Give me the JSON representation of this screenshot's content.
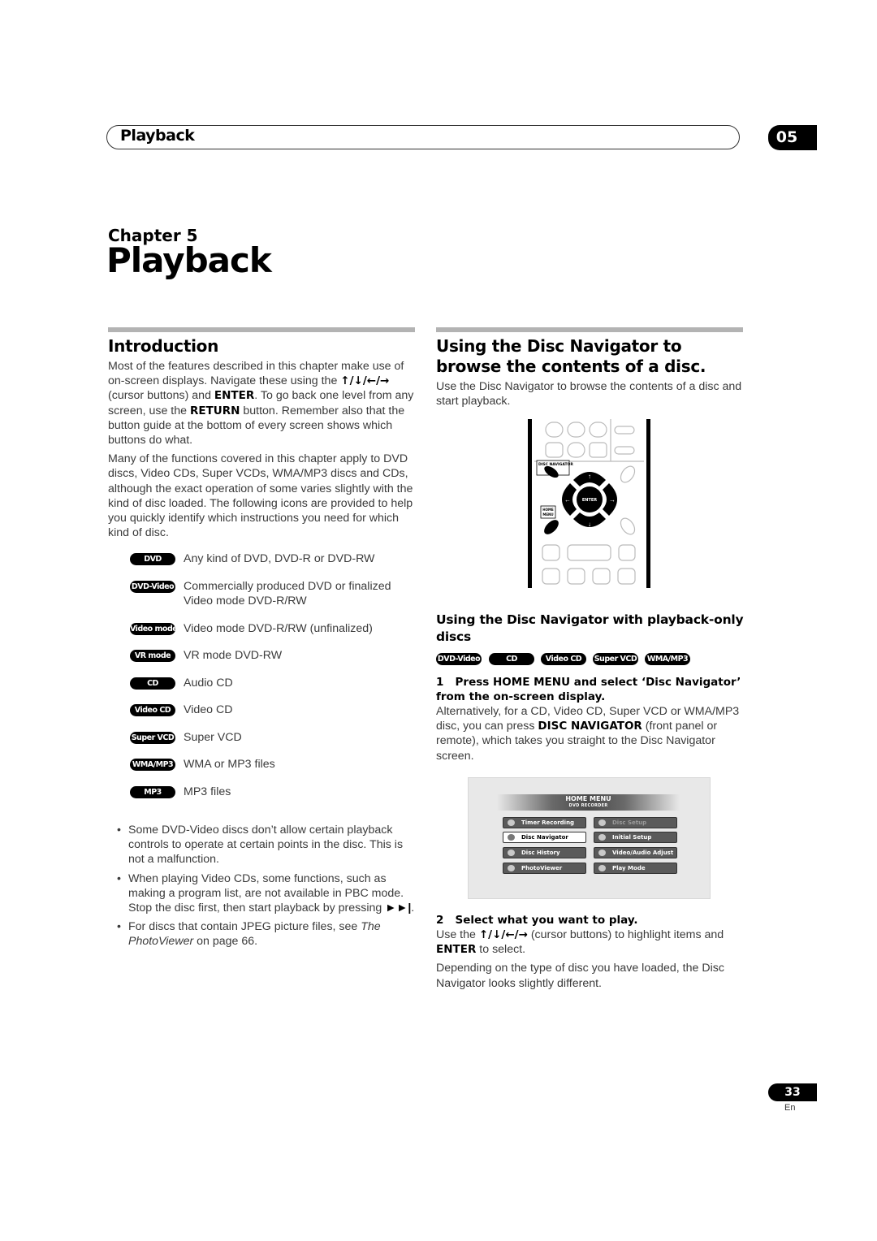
{
  "header": {
    "section_title": "Playback",
    "chapter_number": "05"
  },
  "chapter": {
    "label": "Chapter 5",
    "title": "Playback"
  },
  "introduction": {
    "heading": "Introduction",
    "para1": {
      "t1": "Most of the features described in this chapter make use of on-screen displays. Navigate these using the ",
      "arrows": "↑/↓/←/→",
      "t2": " (cursor buttons) and ",
      "b1": "ENTER",
      "t3": ". To go back one level from any screen, use the ",
      "b2": "RETURN",
      "t4": " button. Remember also that the button guide at the bottom of every screen shows which buttons do what."
    },
    "para2": "Many of the functions covered in this chapter apply to DVD discs, Video CDs, Super VCDs, WMA/MP3 discs and CDs, although the exact operation of some varies slightly with the kind of disc loaded. The following icons are provided to help you quickly identify which instructions you need for which kind of disc.",
    "disc_icons": [
      {
        "badge": "DVD",
        "desc": "Any kind of DVD, DVD-R or DVD-RW"
      },
      {
        "badge": "DVD-Video",
        "desc": "Commercially produced DVD or finalized Video mode DVD-R/RW"
      },
      {
        "badge": "Video mode",
        "desc": "Video mode DVD-R/RW (unfinalized)"
      },
      {
        "badge": "VR mode",
        "desc": "VR mode DVD-RW"
      },
      {
        "badge": "CD",
        "desc": "Audio CD"
      },
      {
        "badge": "Video CD",
        "desc": "Video CD"
      },
      {
        "badge": "Super VCD",
        "desc": "Super VCD"
      },
      {
        "badge": "WMA/MP3",
        "desc": "WMA or MP3 files"
      },
      {
        "badge": "MP3",
        "desc": "MP3 files"
      }
    ],
    "bullets": [
      {
        "text": "Some DVD-Video discs don’t allow certain playback controls to operate at certain points in the disc. This is not a malfunction."
      },
      {
        "text_before": "When playing Video CDs, some functions, such as making a program list, are not available in PBC mode. Stop the disc first, then start playback by pressing ",
        "symbol": "►►|",
        "text_after": "."
      },
      {
        "t1": "For discs that contain JPEG picture files, see ",
        "italic": "The PhotoViewer",
        "t2": " on page 66."
      }
    ],
    "bullet_char": "•"
  },
  "disc_navigator": {
    "heading": "Using the Disc Navigator to browse the contents of a disc.",
    "intro": "Use the Disc Navigator to browse the contents of a disc and start playback.",
    "remote": {
      "disc_navigator_label": "DISC NAVIGATOR",
      "home_menu_label_1": "HOME",
      "home_menu_label_2": "MENU",
      "enter_label": "ENTER"
    },
    "subheading": "Using the Disc Navigator with playback-only discs",
    "badges": [
      "DVD-Video",
      "CD",
      "Video CD",
      "Super VCD",
      "WMA/MP3"
    ],
    "step1": {
      "number": "1",
      "title": "Press HOME MENU and select ‘Disc Navigator’ from the on-screen display.",
      "t1": "Alternatively, for a CD, Video CD, Super VCD or WMA/MP3 disc, you can press ",
      "b1": "DISC NAVIGATOR",
      "t2": " (front panel or remote), which takes you straight to the Disc Navigator screen."
    },
    "home_menu": {
      "title": "HOME MENU",
      "subtitle": "DVD RECORDER",
      "left_items": [
        "Timer Recording",
        "Disc Navigator",
        "Disc History",
        "PhotoViewer"
      ],
      "right_items": [
        "Disc Setup",
        "Initial Setup",
        "Video/Audio Adjust",
        "Play Mode"
      ],
      "selected": "Disc Navigator",
      "disabled": "Disc Setup"
    },
    "step2": {
      "number": "2",
      "title": "Select what you want to play.",
      "t1": "Use the ",
      "arrows": "↑/↓/←/→",
      "t2": " (cursor buttons) to highlight items and ",
      "b1": "ENTER",
      "t3": " to select.",
      "para2": "Depending on the type of disc you have loaded, the Disc Navigator looks slightly different."
    }
  },
  "footer": {
    "page_number": "33",
    "language": "En"
  }
}
